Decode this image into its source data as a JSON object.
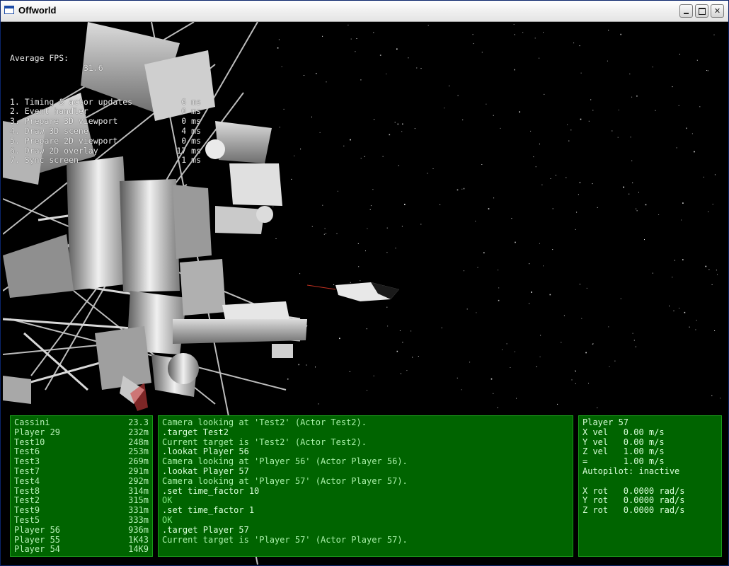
{
  "window": {
    "title": "Offworld"
  },
  "stats": {
    "fps_label": "Average FPS:",
    "fps_value": "31.6",
    "rows": [
      {
        "label": "1. Timing & actor updates",
        "value": "6 ms"
      },
      {
        "label": "2. Event handler",
        "value": "0 ms"
      },
      {
        "label": "3. Prepare 3D viewport",
        "value": "0 ms"
      },
      {
        "label": "4. Draw 3D scene",
        "value": "4 ms"
      },
      {
        "label": "5. Prepare 2D viewport",
        "value": "0 ms"
      },
      {
        "label": "6. Draw 2D overlay",
        "value": "17 ms"
      },
      {
        "label": "7. Sync screen",
        "value": "1 ms"
      }
    ]
  },
  "targets": [
    {
      "name": "Cassini",
      "distance": "23.3"
    },
    {
      "name": "Player 29",
      "distance": "232m"
    },
    {
      "name": "Test10",
      "distance": "248m"
    },
    {
      "name": "Test6",
      "distance": "253m"
    },
    {
      "name": "Test3",
      "distance": "269m"
    },
    {
      "name": "Test7",
      "distance": "291m"
    },
    {
      "name": "Test4",
      "distance": "292m"
    },
    {
      "name": "Test8",
      "distance": "314m"
    },
    {
      "name": "Test2",
      "distance": "315m"
    },
    {
      "name": "Test9",
      "distance": "331m"
    },
    {
      "name": "Test5",
      "distance": "333m"
    },
    {
      "name": "Player 56",
      "distance": "936m"
    },
    {
      "name": "Player 55",
      "distance": "1K43"
    },
    {
      "name": "Player 54",
      "distance": "14K9"
    }
  ],
  "console": [
    {
      "text": "Camera looking at 'Test2' (Actor Test2).",
      "kind": "info"
    },
    {
      "text": ".target Test2",
      "kind": "cmd"
    },
    {
      "text": "Current target is 'Test2' (Actor Test2).",
      "kind": "info"
    },
    {
      "text": ".lookat Player 56",
      "kind": "cmd"
    },
    {
      "text": "Camera looking at 'Player 56' (Actor Player 56).",
      "kind": "info"
    },
    {
      "text": ".lookat Player 57",
      "kind": "cmd"
    },
    {
      "text": "Camera looking at 'Player 57' (Actor Player 57).",
      "kind": "info"
    },
    {
      "text": ".set time_factor 10",
      "kind": "cmd"
    },
    {
      "text": "OK",
      "kind": "resp"
    },
    {
      "text": ".set time_factor 1",
      "kind": "cmd"
    },
    {
      "text": "OK",
      "kind": "resp"
    },
    {
      "text": ".target Player 57",
      "kind": "cmd"
    },
    {
      "text": "Current target is 'Player 57' (Actor Player 57).",
      "kind": "info"
    }
  ],
  "player_info": {
    "name": "Player 57",
    "lines": [
      "X vel   0.00 m/s",
      "Y vel   0.00 m/s",
      "Z vel   1.00 m/s",
      "=       1.00 m/s",
      "Autopilot: inactive",
      "",
      "X rot   0.0000 rad/s",
      "Y rot   0.0000 rad/s",
      "Z rot   0.0000 rad/s"
    ]
  },
  "colors": {
    "panel_bg": "#006400",
    "panel_text": "#b6f0b6",
    "console_info": "#a8f0a8",
    "console_cmd": "#d8ffd8",
    "console_resp": "#7ee87e"
  }
}
